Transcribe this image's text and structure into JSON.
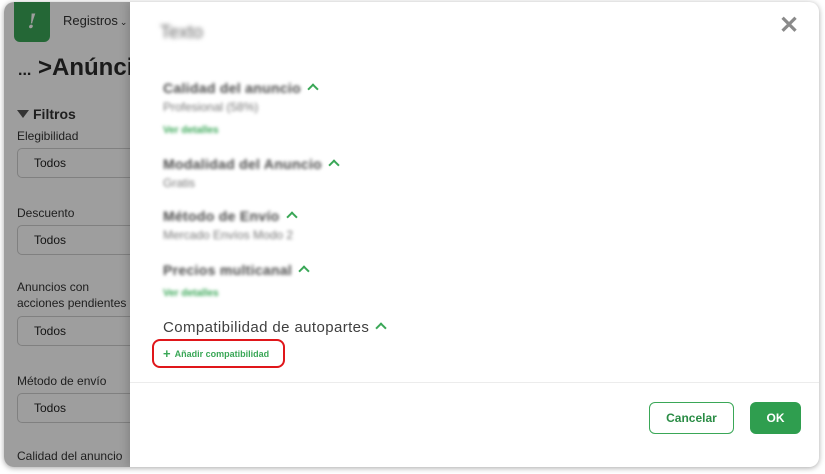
{
  "app": {
    "logo_text": "!",
    "nav_label": "Registros",
    "breadcrumb_dots": "...",
    "breadcrumb_sep": ">",
    "breadcrumb_title": "Anúncios"
  },
  "filters": {
    "title": "Filtros",
    "groups": [
      {
        "label": "Elegibilidad",
        "value": "Todos"
      },
      {
        "label": "Descuento",
        "value": "Todos"
      },
      {
        "label": "Anuncios con acciones pendientes",
        "value": "Todos"
      },
      {
        "label": "Método de envío",
        "value": "Todos"
      },
      {
        "label": "Calidad del anuncio",
        "value": ""
      }
    ]
  },
  "modal": {
    "title": "Texto",
    "sections": [
      {
        "title": "Calidad del anuncio",
        "value": "Profesional (58%)",
        "link": "Ver detalles"
      },
      {
        "title": "Modalidad del Anuncio",
        "value": "Gratis",
        "link": ""
      },
      {
        "title": "Método de Envío",
        "value": "Mercado Envíos Modo 2",
        "link": ""
      },
      {
        "title": "Precios multicanal",
        "value": "",
        "link": "Ver detalles"
      }
    ],
    "compat_title": "Compatibilidad de autopartes",
    "add_compat_label": "Añadir compatibilidad",
    "cancel_label": "Cancelar",
    "ok_label": "OK"
  },
  "colors": {
    "brand_green": "#3aa757",
    "highlight_red": "#e0161a"
  }
}
